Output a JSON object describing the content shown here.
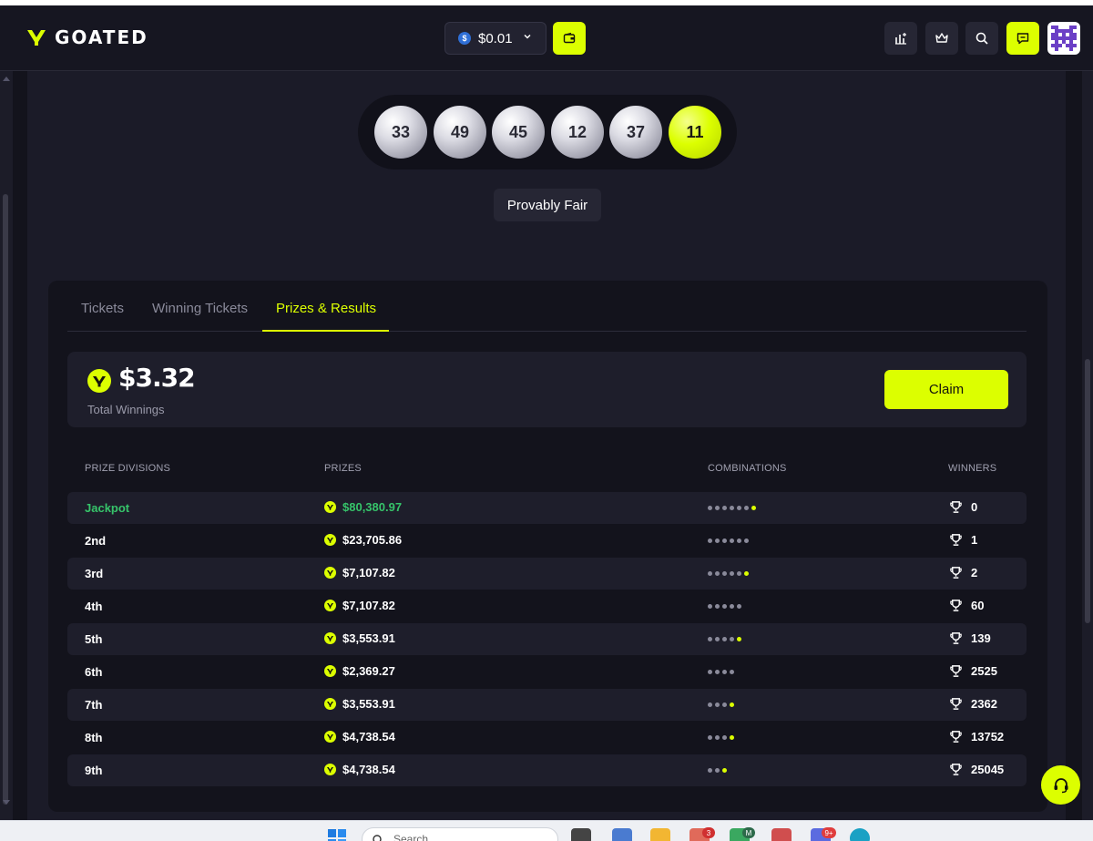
{
  "header": {
    "brand": "GOATED",
    "balance": "$0.01",
    "balance_coin_symbol": "$",
    "icons": [
      "stats-icon",
      "crown-icon",
      "search-icon",
      "chat-icon"
    ]
  },
  "draw": {
    "balls": [
      "33",
      "49",
      "45",
      "12",
      "37",
      "11"
    ],
    "bonus_ball": "11"
  },
  "provably_fair_label": "Provably Fair",
  "tabs": [
    {
      "label": "Tickets",
      "active": false
    },
    {
      "label": "Winning Tickets",
      "active": false
    },
    {
      "label": "Prizes & Results",
      "active": true
    }
  ],
  "winnings": {
    "amount": "$3.32",
    "label": "Total Winnings",
    "claim_label": "Claim"
  },
  "table": {
    "headers": [
      "PRIZE DIVISIONS",
      "PRIZES",
      "COMBINATIONS",
      "WINNERS"
    ],
    "rows": [
      {
        "division": "Jackpot",
        "prize": "$80,380.97",
        "grey": 6,
        "bonus": 1,
        "winners": "0",
        "highlight": true
      },
      {
        "division": "2nd",
        "prize": "$23,705.86",
        "grey": 6,
        "bonus": 0,
        "winners": "1"
      },
      {
        "division": "3rd",
        "prize": "$7,107.82",
        "grey": 5,
        "bonus": 1,
        "winners": "2"
      },
      {
        "division": "4th",
        "prize": "$7,107.82",
        "grey": 5,
        "bonus": 0,
        "winners": "60"
      },
      {
        "division": "5th",
        "prize": "$3,553.91",
        "grey": 4,
        "bonus": 1,
        "winners": "139"
      },
      {
        "division": "6th",
        "prize": "$2,369.27",
        "grey": 4,
        "bonus": 0,
        "winners": "2525"
      },
      {
        "division": "7th",
        "prize": "$3,553.91",
        "grey": 3,
        "bonus": 1,
        "winners": "2362"
      },
      {
        "division": "8th",
        "prize": "$4,738.54",
        "grey": 3,
        "bonus": 1,
        "winners": "13752"
      },
      {
        "division": "9th",
        "prize": "$4,738.54",
        "grey": 2,
        "bonus": 1,
        "winners": "25045"
      }
    ]
  },
  "taskbar": {
    "search_placeholder": "Search",
    "badges": [
      "3",
      "M",
      "9+"
    ]
  },
  "colors": {
    "accent": "#dcff00",
    "jackpot": "#36c46a",
    "background": "#1b1b28",
    "card": "#13131c"
  }
}
